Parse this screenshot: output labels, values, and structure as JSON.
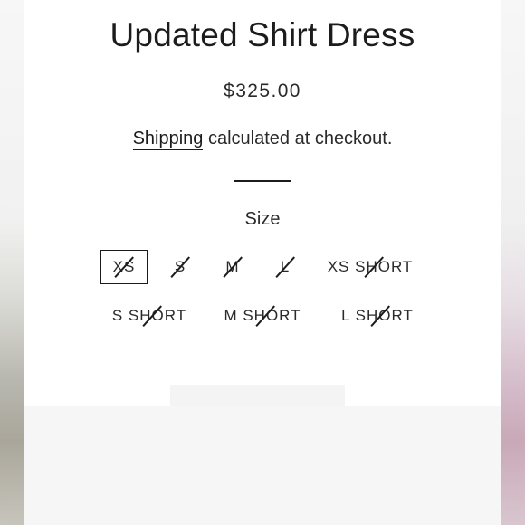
{
  "product": {
    "title": "Updated Shirt Dress",
    "price": "$325.00",
    "shipping_link": "Shipping",
    "shipping_suffix": " calculated at checkout."
  },
  "size_picker": {
    "label": "Size",
    "selected": "XS",
    "options": [
      {
        "label": "XS",
        "available": false
      },
      {
        "label": "S",
        "available": false
      },
      {
        "label": "M",
        "available": false
      },
      {
        "label": "L",
        "available": false
      },
      {
        "label": "XS SHORT",
        "available": false
      },
      {
        "label": "S SHORT",
        "available": false
      },
      {
        "label": "M SHORT",
        "available": false
      },
      {
        "label": "L SHORT",
        "available": false
      }
    ]
  },
  "colors": {
    "text": "#1c1c1c",
    "background": "#ffffff",
    "panel": "#f6f6f6"
  }
}
